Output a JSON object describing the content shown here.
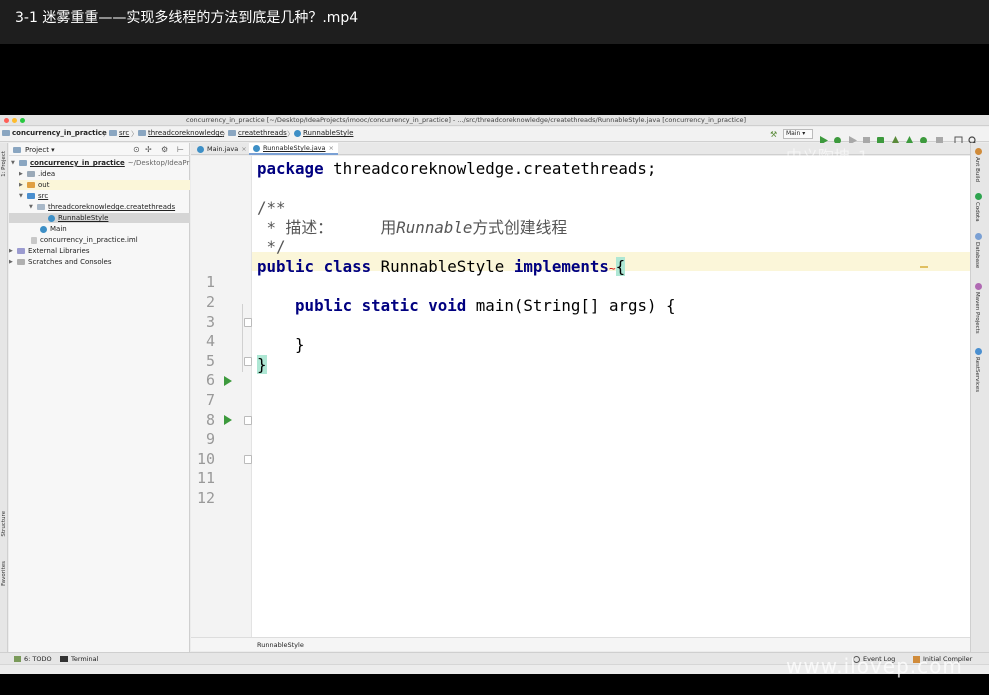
{
  "video": {
    "title": "3-1 迷雾重重——实现多线程的方法到底是几种？.mp4"
  },
  "window": {
    "title": "concurrency_in_practice [~/Desktop/IdeaProjects/imooc/concurrency_in_practice] - .../src/threadcoreknowledge/createthreads/RunnableStyle.java [concurrency_in_practice]",
    "colors": {
      "close": "#ff5f57",
      "minimize": "#febc2e",
      "maximize": "#28c840"
    }
  },
  "breadcrumb": {
    "items": [
      "concurrency_in_practice",
      "src",
      "threadcoreknowledge",
      "createthreads",
      "RunnableStyle"
    ]
  },
  "toolbar": {
    "run_config": "Main",
    "icons": [
      "hammer-icon",
      "run-icon",
      "debug-icon",
      "coverage-icon",
      "profile-icon",
      "build-icon",
      "stop-icon",
      "search-icon"
    ]
  },
  "project_panel": {
    "header_label": "Project",
    "tree": [
      {
        "label": "concurrency_in_practice",
        "suffix": "~/Desktop/IdeaPr",
        "level": 0,
        "arrow": "▼",
        "icon": "folder"
      },
      {
        "label": ".idea",
        "level": 1,
        "arrow": "▶",
        "icon": "folder"
      },
      {
        "label": "out",
        "level": 1,
        "arrow": "▶",
        "icon": "folder-orange"
      },
      {
        "label": "src",
        "level": 1,
        "arrow": "▼",
        "icon": "folder-blue"
      },
      {
        "label": "threadcoreknowledge.createthreads",
        "level": 2,
        "arrow": "▼",
        "icon": "package"
      },
      {
        "label": "RunnableStyle",
        "level": 3,
        "arrow": "",
        "icon": "class"
      },
      {
        "label": "Main",
        "level": 2,
        "arrow": "",
        "icon": "class"
      },
      {
        "label": "concurrency_in_practice.iml",
        "level": 1,
        "arrow": "",
        "icon": "file"
      },
      {
        "label": "External Libraries",
        "level": 0,
        "arrow": "▶",
        "icon": "library"
      },
      {
        "label": "Scratches and Consoles",
        "level": 0,
        "arrow": "▶",
        "icon": "scratch"
      }
    ]
  },
  "editor_tabs": [
    {
      "label": "Main.java",
      "active": false
    },
    {
      "label": "RunnableStyle.java",
      "active": true
    }
  ],
  "code": {
    "line_numbers": [
      "1",
      "2",
      "3",
      "4",
      "5",
      "6",
      "7",
      "8",
      "9",
      "10",
      "11",
      "12"
    ],
    "package_kw": "package",
    "package_name": " threadcoreknowledge.createthreads;",
    "doc_open": "/**",
    "doc_star": " * 描述：     用",
    "doc_italic": "Runnable",
    "doc_rest": "方式创建线程",
    "doc_close": " */",
    "public_kw": "public",
    "class_kw": "class",
    "class_name": "RunnableStyle",
    "implements_kw": "implements",
    "open_brace": "{",
    "static_kw": "static",
    "void_kw": "void",
    "main_sig": "main(String[] args) {",
    "close_inner": "}",
    "close_outer": "}"
  },
  "footer_breadcrumb": "RunnableStyle",
  "bottom_tools": {
    "todo": "6: TODO",
    "terminal": "Terminal",
    "event_log": "Event Log",
    "initial_compiler": "Initial Compiler"
  },
  "left_tools": [
    "1: Project",
    "Structure",
    "Favorites"
  ],
  "right_tools": [
    "Ant Build",
    "Codota",
    "Database",
    "Maven Projects",
    "RestServices"
  ],
  "watermarks": {
    "top": "中义陶坤_1",
    "bottom": "www.ilovep.com"
  }
}
